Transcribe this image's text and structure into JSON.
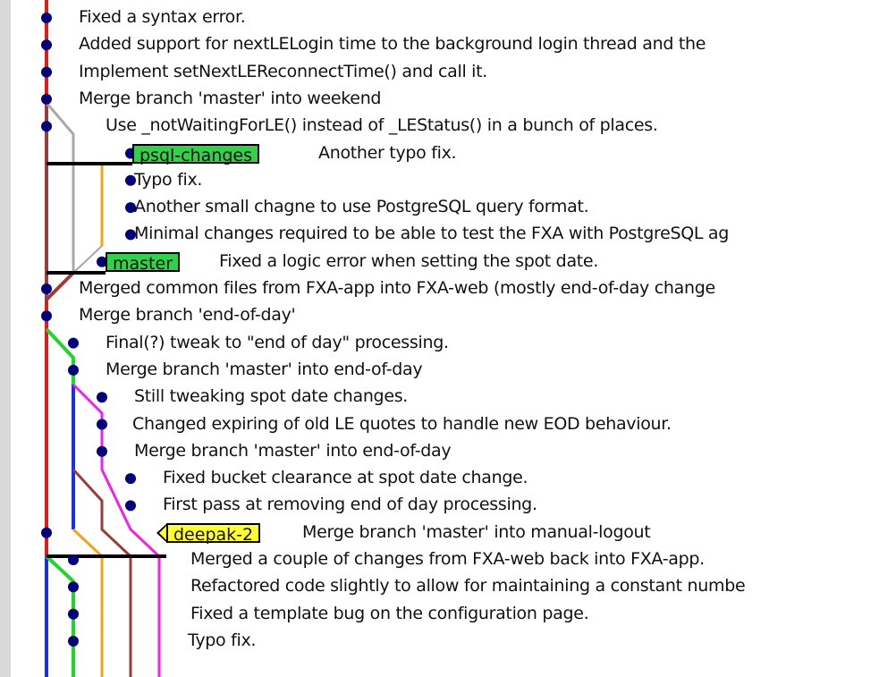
{
  "graph": {
    "colors": {
      "red": "#e21a1a",
      "brown": "#9b3b3b",
      "grey": "#a8a8a8",
      "orange": "#f2a31a",
      "green": "#22d52a",
      "magenta": "#ee22ee",
      "blue": "#1a2ee8",
      "black": "#000000",
      "node": "#00007a"
    },
    "commits": [
      {
        "message": "Fixed a syntax error."
      },
      {
        "message": "Added support for nextLELogin time to the background login thread and the"
      },
      {
        "message": "Implement setNextLEReconnectTime() and call it."
      },
      {
        "message": "Merge branch 'master' into weekend"
      },
      {
        "message": "Use _notWaitingForLE() instead of _LEStatus() in a bunch of places."
      },
      {
        "message": "Another typo fix.",
        "ref": {
          "label": "psql-changes",
          "kind": "branch"
        }
      },
      {
        "message": "Typo fix."
      },
      {
        "message": "Another small chagne to use PostgreSQL query format."
      },
      {
        "message": "Minimal changes required to be able to test the FXA with PostgreSQL ag"
      },
      {
        "message": "Fixed a logic error when setting the spot date.",
        "ref": {
          "label": "master",
          "kind": "branch"
        }
      },
      {
        "message": "Merged common files from FXA-app into FXA-web (mostly end-of-day change"
      },
      {
        "message": "Merge branch 'end-of-day'"
      },
      {
        "message": "Final(?) tweak to \"end of day\" processing."
      },
      {
        "message": "Merge branch 'master' into end-of-day"
      },
      {
        "message": "Still tweaking spot date changes."
      },
      {
        "message": "Changed expiring of old LE quotes to handle new EOD behaviour."
      },
      {
        "message": "Merge branch 'master' into end-of-day"
      },
      {
        "message": "Fixed bucket clearance at spot date change."
      },
      {
        "message": "First pass at removing end of day processing."
      },
      {
        "message": "Merge branch 'master' into manual-logout",
        "ref": {
          "label": "deepak-2",
          "kind": "tag"
        }
      },
      {
        "message": "Merged a couple of changes from FXA-web back into FXA-app."
      },
      {
        "message": "Refactored code slightly to allow for maintaining a constant numbe"
      },
      {
        "message": "Fixed a template bug on the configuration page."
      },
      {
        "message": "Typo fix."
      }
    ]
  }
}
